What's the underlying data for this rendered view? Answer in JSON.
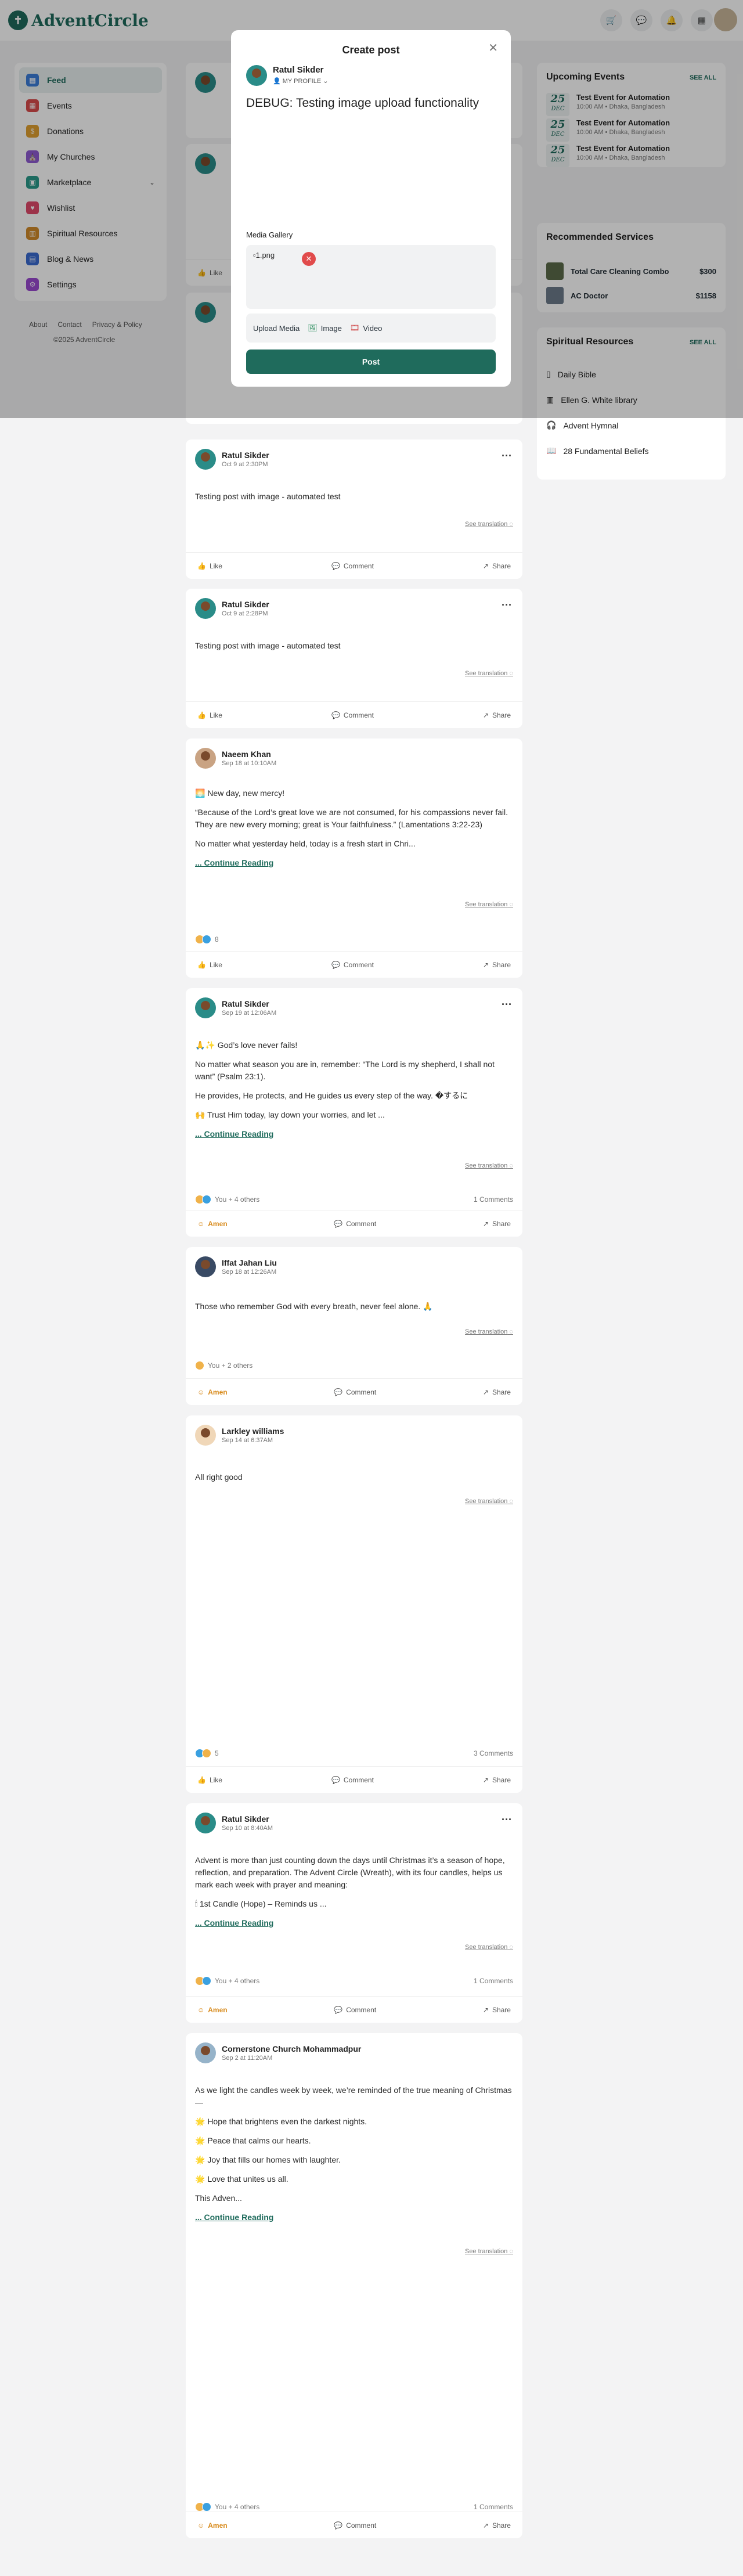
{
  "app": {
    "logo_text": "AdventCircle"
  },
  "topbar": {
    "icons": [
      "cart-icon",
      "chat-icon",
      "bell-icon",
      "grid-icon"
    ]
  },
  "sidebar": {
    "items": [
      {
        "label": "Feed",
        "color": "#3b7dd8"
      },
      {
        "label": "Events",
        "color": "#d94b4b"
      },
      {
        "label": "Donations",
        "color": "#e0a030"
      },
      {
        "label": "My Churches",
        "color": "#8e5bd1"
      },
      {
        "label": "Marketplace",
        "color": "#2a9a8a"
      },
      {
        "label": "Wishlist",
        "color": "#e04a6a"
      },
      {
        "label": "Spiritual Resources",
        "color": "#d08a2a"
      },
      {
        "label": "Blog & News",
        "color": "#3a6ad0"
      },
      {
        "label": "Settings",
        "color": "#9a4ad0"
      }
    ],
    "footer_links": [
      "About",
      "Contact",
      "Privacy & Policy"
    ],
    "copyright": "©2025 AdventCircle"
  },
  "modal": {
    "title": "Create post",
    "user_name": "Ratul Sikder",
    "audience": "MY PROFILE",
    "text": "DEBUG: Testing image upload functionality",
    "gallery_label": "Media Gallery",
    "image_name": "1.png",
    "upload_label": "Upload Media",
    "image_label": "Image",
    "video_label": "Video",
    "post_label": "Post"
  },
  "posts": [
    {
      "name": "Ratul Sikder",
      "time": "Oct 9 at 2:30PM",
      "text": "Testing post with image - automated test",
      "see_translation": "See translation",
      "like": "Like",
      "comment": "Comment",
      "share": "Share"
    },
    {
      "name": "Ratul Sikder",
      "time": "Oct 9 at 2:28PM",
      "text": "Testing post with image - automated test",
      "see_translation": "See translation",
      "like": "Like",
      "comment": "Comment",
      "share": "Share"
    },
    {
      "name": "Naeem Khan",
      "time": "Sep 18 at 10:10AM",
      "paragraphs": [
        "🌅 New day, new mercy!",
        "“Because of the Lord’s great love we are not consumed, for his compassions never fail. They are new every morning; great is Your faithfulness.” (Lamentations 3:22-23)",
        "No matter what yesterday held, today is a fresh start in Chri..."
      ],
      "continue": "... Continue Reading",
      "see_translation": "See translation",
      "reactions": "8",
      "like": "Like",
      "comment": "Comment",
      "share": "Share"
    },
    {
      "name": "Ratul Sikder",
      "time": "Sep 19 at 12:06AM",
      "paragraphs": [
        "🙏✨ God’s love never fails!",
        "No matter what season you are in, remember: “The Lord is my shepherd, I shall not want” (Psalm 23:1).",
        "He provides, He protects, and He guides us every step of the way. �するに",
        "🙌 Trust Him today, lay down your worries, and let ..."
      ],
      "continue": "... Continue Reading",
      "see_translation": "See translation",
      "reactions": "You + 4 others",
      "comments": "1 Comments",
      "like": "Amen",
      "comment": "Comment",
      "share": "Share"
    },
    {
      "name": "Iffat Jahan Liu",
      "time": "Sep 18 at 12:26AM",
      "text": "Those who remember God with every breath, never feel alone. 🙏",
      "see_translation": "See translation",
      "reactions": "You + 2 others",
      "like": "Amen",
      "comment": "Comment",
      "share": "Share"
    },
    {
      "name": "Larkley williams",
      "time": "Sep 14 at 6:37AM",
      "text": "All right good",
      "see_translation": "See translation",
      "reactions": "5",
      "comments": "3 Comments",
      "like": "Like",
      "comment": "Comment",
      "share": "Share"
    },
    {
      "name": "Ratul Sikder",
      "time": "Sep 10 at 8:40AM",
      "paragraphs": [
        "Advent is more than just counting down the days until Christmas it’s a season of hope, reflection, and preparation. The Advent Circle (Wreath), with its four candles, helps us mark each week with prayer and meaning:",
        "🕯 1st Candle (Hope) – Reminds us ..."
      ],
      "continue": "... Continue Reading",
      "see_translation": "See translation",
      "reactions": "You + 4 others",
      "comments": "1 Comments",
      "like": "Amen",
      "comment": "Comment",
      "share": "Share"
    },
    {
      "name": "Cornerstone Church Mohammadpur",
      "time": "Sep 2 at 11:20AM",
      "paragraphs": [
        "As we light the candles week by week, we’re reminded of the true meaning of Christmas—",
        "🌟 Hope that brightens even the darkest nights.",
        "🌟 Peace that calms our hearts.",
        "🌟 Joy that fills our homes with laughter.",
        "🌟 Love that unites us all.",
        "This Adven..."
      ],
      "continue": "... Continue Reading",
      "see_translation": "See translation",
      "reactions": "You + 4 others",
      "comments": "1 Comments",
      "like": "Amen",
      "comment": "Comment",
      "share": "Share"
    }
  ],
  "right": {
    "events_title": "Upcoming Events",
    "see_all": "SEE ALL",
    "events": [
      {
        "day": "25",
        "month": "DEC",
        "title": "Test Event for Automation",
        "meta": "10:00 AM • Dhaka, Bangladesh"
      },
      {
        "day": "25",
        "month": "DEC",
        "title": "Test Event for Automation",
        "meta": "10:00 AM • Dhaka, Bangladesh"
      },
      {
        "day": "25",
        "month": "DEC",
        "title": "Test Event for Automation",
        "meta": "10:00 AM • Dhaka, Bangladesh"
      }
    ],
    "services_title": "Recommended Services",
    "services": [
      {
        "name": "Total Care Cleaning Combo",
        "price": "$300"
      },
      {
        "name": "AC Doctor",
        "price": "$1158"
      }
    ],
    "resources_title": "Spiritual Resources",
    "resources": [
      "Daily Bible",
      "Ellen G. White library",
      "Advent Hymnal",
      "28 Fundamental Beliefs"
    ]
  }
}
